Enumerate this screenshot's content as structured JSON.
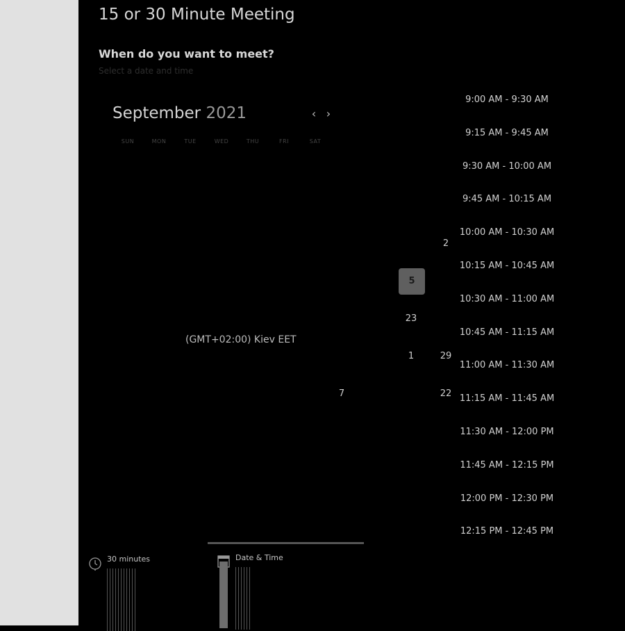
{
  "meeting": {
    "title": "15 or 30 Minute Meeting",
    "question": "When do you want to meet?",
    "instruction": "Select a date and time"
  },
  "calendar": {
    "month": "September",
    "year": "2021",
    "prev_icon": "chevron-left-icon",
    "next_icon": "chevron-right-icon",
    "weekdays": [
      "SUN",
      "MON",
      "TUE",
      "WED",
      "THU",
      "FRI",
      "SAT"
    ],
    "visible_days": [
      "2",
      "5",
      "23",
      "1",
      "29",
      "7",
      "22"
    ],
    "selected_day": "5"
  },
  "timezone": "(GMT+02:00) Kiev EET",
  "time_slots": [
    "9:00 AM - 9:30 AM",
    "9:15 AM - 9:45 AM",
    "9:30 AM - 10:00 AM",
    "9:45 AM - 10:15 AM",
    "10:00 AM - 10:30 AM",
    "10:15 AM - 10:45 AM",
    "10:30 AM - 11:00 AM",
    "10:45 AM - 11:15 AM",
    "11:00 AM - 11:30 AM",
    "11:15 AM - 11:45 AM",
    "11:30 AM - 12:00 PM",
    "11:45 AM - 12:15 PM",
    "12:00 PM - 12:30 PM",
    "12:15 PM - 12:45 PM"
  ],
  "steps": [
    {
      "label": "30 minutes",
      "icon": "clock-icon"
    },
    {
      "label": "Date & Time",
      "icon": "calendar-icon"
    }
  ],
  "colors": {
    "background": "#000000",
    "gutter": "#e1e1e1",
    "selected_day_bg": "#5f5f5f",
    "progress_bar": "#555555"
  }
}
